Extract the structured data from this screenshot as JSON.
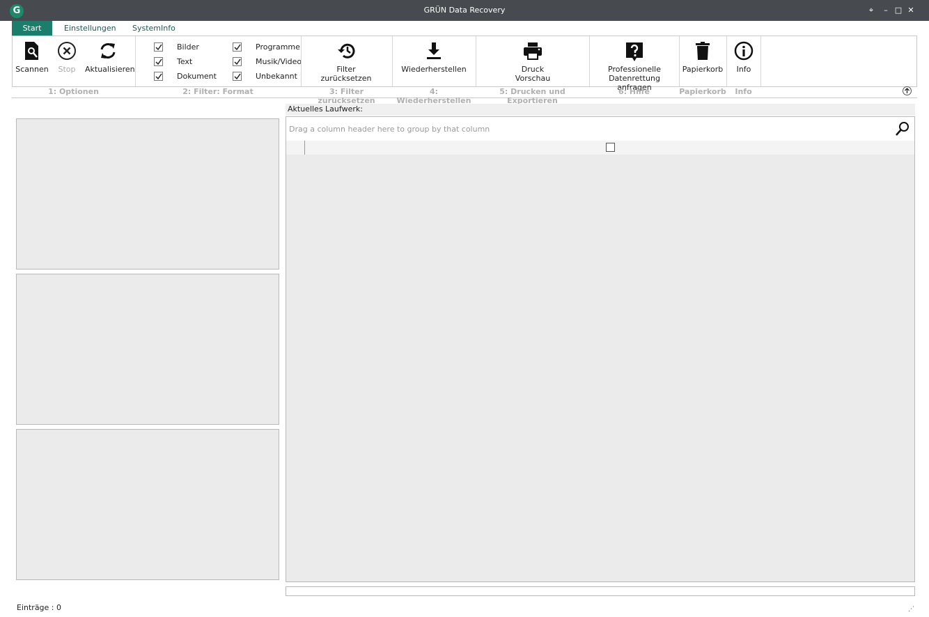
{
  "window": {
    "logo_letter": "G",
    "title": "GRÜN Data Recovery",
    "controls": [
      "⌖",
      "–",
      "□",
      "✕"
    ]
  },
  "tabs": [
    {
      "label": "Start",
      "active": true
    },
    {
      "label": "Einstellungen",
      "active": false
    },
    {
      "label": "SystemInfo",
      "active": false
    }
  ],
  "ribbon": {
    "scan_label": "Scannen",
    "stop_label": "Stop",
    "refresh_label": "Aktualisieren",
    "filters": [
      {
        "label": "Bilder",
        "checked": true
      },
      {
        "label": "Text",
        "checked": true
      },
      {
        "label": "Dokument",
        "checked": true
      },
      {
        "label": "Programme",
        "checked": true
      },
      {
        "label": "Musik/Video",
        "checked": true
      },
      {
        "label": "Unbekannt",
        "checked": true
      }
    ],
    "reset_label_1": "Filter",
    "reset_label_2": "zurücksetzen",
    "restore_label": "Wiederherstellen",
    "print_label_1": "Druck",
    "print_label_2": "Vorschau",
    "pro_label_1": "Professionelle",
    "pro_label_2": "Datenrettung anfragen",
    "recycle_label": "Papierkorb",
    "info_label": "Info"
  },
  "groups": [
    "1: Optionen",
    "2: Filter: Format",
    "3: Filter zurücksetzen",
    "4: Wiederherstellen",
    "5: Drucken und Exportieren",
    "6: Hilfe",
    "Papierkorb",
    "Info"
  ],
  "main": {
    "drive_label": "Aktuelles Laufwerk:",
    "group_hint": "Drag a column header here to group by that column"
  },
  "status": {
    "entries_label": "Einträge : 0"
  },
  "colors": {
    "accent": "#1b7e6c",
    "titlebar": "#474b4f"
  }
}
